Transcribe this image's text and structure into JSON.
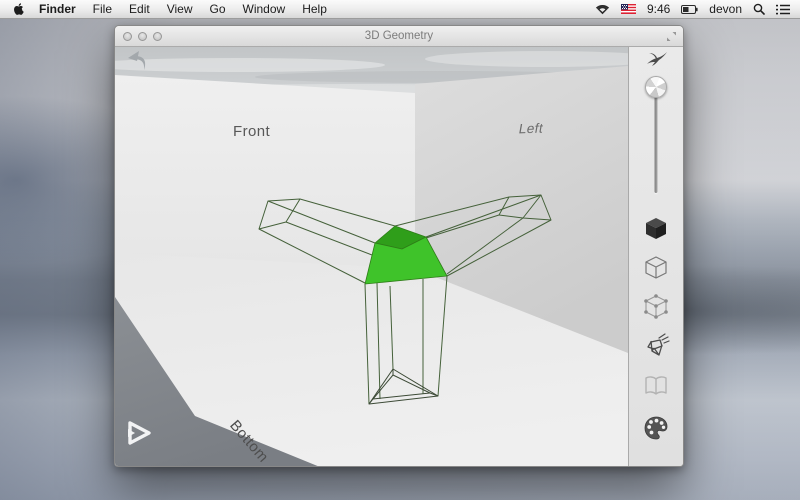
{
  "menu_bar": {
    "items": [
      "Finder",
      "File",
      "Edit",
      "View",
      "Go",
      "Window",
      "Help"
    ],
    "status": {
      "time": "9:46",
      "user": "devon"
    },
    "status_icons": [
      "wifi-icon",
      "us-flag-icon",
      "battery-icon",
      "spotlight-search-icon",
      "notification-list-icon"
    ]
  },
  "window": {
    "title": "3D Geometry",
    "traffic_lights": [
      "close",
      "minimize",
      "zoom"
    ]
  },
  "canvas": {
    "labels": {
      "front": "Front",
      "left": "Left",
      "bottom": "Bottom"
    },
    "icons": [
      "undo-arrow-icon",
      "next-step-icon"
    ],
    "selection": "center hub face of wireframe tetrapod highlighted green"
  },
  "sidebar": {
    "tools": [
      "bird-swoop",
      "zoom-slider",
      "solid-cube",
      "wireframe-cube",
      "vertex-cube",
      "explode-cube",
      "handbook",
      "palette"
    ]
  },
  "colors": {
    "selection_green": "#3fc32a",
    "selection_green_dark": "#2f9e1a",
    "wireframe": "#45613a",
    "front_wall": "#ececec",
    "left_wall": "#d8d8d8",
    "floor": "#eaeaea",
    "outside_corner": "#868a90"
  }
}
